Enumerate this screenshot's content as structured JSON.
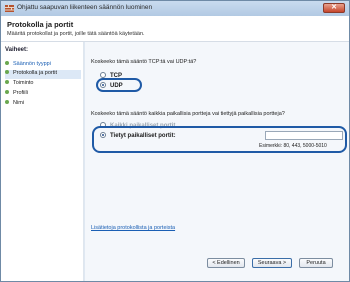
{
  "window": {
    "title": "Ohjattu saapuvan liikenteen säännön luominen",
    "close_label": "✕"
  },
  "header": {
    "title": "Protokolla ja portit",
    "subtitle": "Määritä protokollat ja portit, joille tätä sääntöä käytetään."
  },
  "steps": {
    "heading": "Vaiheet:",
    "items": [
      {
        "label": "Säännön tyyppi"
      },
      {
        "label": "Protokolla ja portit"
      },
      {
        "label": "Toiminto"
      },
      {
        "label": "Profiili"
      },
      {
        "label": "Nimi"
      }
    ]
  },
  "protocol": {
    "question": "Koskeeko tämä sääntö TCP:tä vai UDP:tä?",
    "options": [
      {
        "label": "TCP",
        "selected": false
      },
      {
        "label": "UDP",
        "selected": true
      }
    ]
  },
  "ports": {
    "question": "Koskeeko tämä sääntö kaikkia paikallisia portteja vai tiettyjä paikallisia portteja?",
    "options": [
      {
        "label": "Kaikki paikalliset portit",
        "selected": false
      },
      {
        "label": "Tietyt paikalliset portit:",
        "selected": true
      }
    ],
    "input_value": "",
    "example": "Esimerkki: 80, 443, 5000-5010"
  },
  "learn_more": "Lisätietoja protokollista ja porteista",
  "buttons": {
    "back": "< Edellinen",
    "next": "Seuraava >",
    "cancel": "Peruuta"
  },
  "colors": {
    "highlight": "#1f5aa6",
    "link": "#1a5fb4",
    "step_dot": "#6aa84f"
  }
}
